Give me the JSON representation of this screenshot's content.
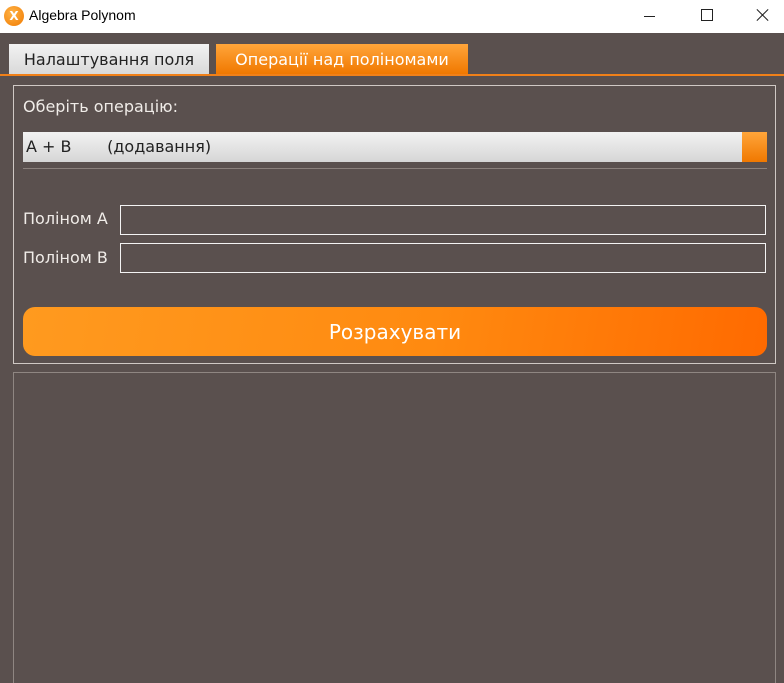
{
  "window": {
    "title": "Algebra Polynom",
    "icon": "x-logo-icon",
    "icon_glyph": "X"
  },
  "tabs": [
    {
      "label": "Налаштування поля",
      "active": false
    },
    {
      "label": "Операції над поліномами",
      "active": true
    }
  ],
  "operation": {
    "label": "Оберіть операцію:",
    "selected": "A + B       (додавання)"
  },
  "polynomials": {
    "a_label": "Поліном A",
    "a_value": "",
    "b_label": "Поліном B",
    "b_value": ""
  },
  "calculate_button": "Розрахувати",
  "colors": {
    "background": "#5a504e",
    "accent": "#ff8a10",
    "text": "#f0ece8"
  }
}
